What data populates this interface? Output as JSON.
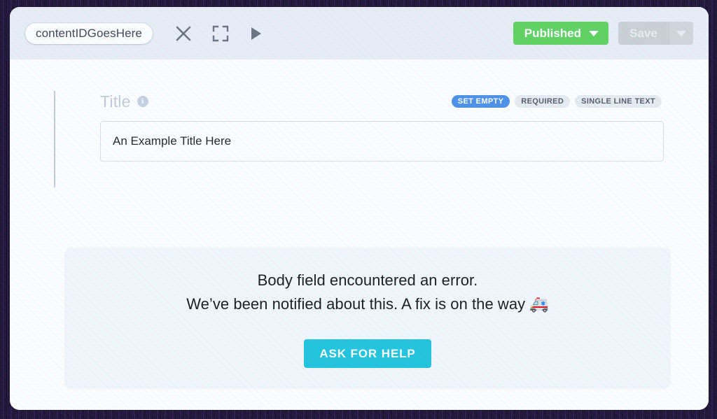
{
  "toolbar": {
    "content_id": "contentIDGoesHere",
    "icons": [
      {
        "name": "close-icon",
        "label": "Close"
      },
      {
        "name": "fullscreen-icon",
        "label": "Fullscreen"
      },
      {
        "name": "play-icon",
        "label": "Preview"
      }
    ],
    "publish": {
      "label": "Published",
      "color": "#5ed25e",
      "text_color": "#ffffff"
    },
    "save": {
      "label": "Save",
      "disabled": true,
      "color": "#ccd0d5",
      "text_color": "#eceef1"
    }
  },
  "field": {
    "label": "Title",
    "info_glyph": "i",
    "value": "An Example Title Here",
    "placeholder": "",
    "badges": [
      {
        "label": "SET EMPTY",
        "style": "blue",
        "color": "#4a8fe7"
      },
      {
        "label": "REQUIRED",
        "style": "grey",
        "color": "#e9ecf1"
      },
      {
        "label": "SINGLE LINE TEXT",
        "style": "grey",
        "color": "#e9ecf1"
      }
    ]
  },
  "error_panel": {
    "line1": "Body field encountered an error.",
    "line2": "We’ve been notified about this. A fix is on the way 🚑",
    "button_label": "ASK FOR HELP",
    "button_color": "#1ec4de",
    "background": "#f4f8fd"
  }
}
